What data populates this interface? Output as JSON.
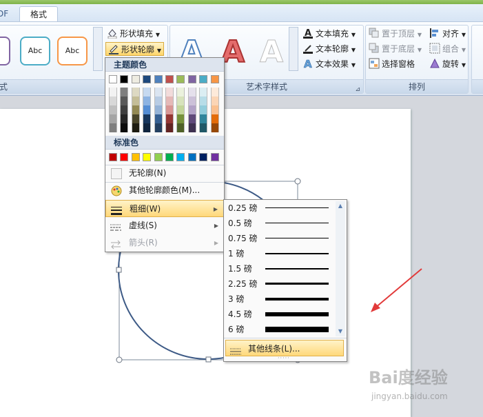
{
  "tabs": {
    "pdf": "DF",
    "format": "格式"
  },
  "ribbon": {
    "shape_styles": {
      "sample": "Abc",
      "label": "式",
      "fill": "形状填充",
      "outline": "形状轮廓"
    },
    "wordart": {
      "label": "艺术字样式",
      "letter": "A",
      "fill": "文本填充",
      "outline": "文本轮廓",
      "effects": "文本效果"
    },
    "arrange": {
      "label": "排列",
      "bring_front": "置于顶层",
      "send_back": "置于底层",
      "selection_pane": "选择窗格",
      "align": "对齐",
      "group": "组合",
      "rotate": "旋转"
    },
    "group_label_left": "式"
  },
  "outline_menu": {
    "theme_colors": "主题颜色",
    "standard_colors": "标准色",
    "no_outline": "无轮廓(N)",
    "more_colors": "其他轮廓颜色(M)...",
    "weight": "粗细(W)",
    "dashes": "虚线(S)",
    "arrows": "箭头(R)"
  },
  "theme_palette": {
    "top": [
      "#ffffff",
      "#000000",
      "#eeece1",
      "#1f497d",
      "#4f81bd",
      "#c0504d",
      "#9bbb59",
      "#8064a2",
      "#4bacc6",
      "#f79646"
    ],
    "shades": [
      [
        "#f2f2f2",
        "#7f7f7f",
        "#ddd9c3",
        "#c6d9f0",
        "#dbe5f1",
        "#f2dcdb",
        "#ebf1dd",
        "#e5e0ec",
        "#dbeef3",
        "#fdeada"
      ],
      [
        "#d8d8d8",
        "#595959",
        "#c4bd97",
        "#8db3e2",
        "#b8cce4",
        "#e5b9b7",
        "#d7e3bc",
        "#ccc1d9",
        "#b7dde8",
        "#fbd5b5"
      ],
      [
        "#bfbfbf",
        "#3f3f3f",
        "#938953",
        "#548dd4",
        "#95b3d7",
        "#d99694",
        "#c3d69b",
        "#b2a2c7",
        "#92cddc",
        "#fac08f"
      ],
      [
        "#a5a5a5",
        "#262626",
        "#494429",
        "#17365d",
        "#366092",
        "#953734",
        "#76923c",
        "#5f497a",
        "#31859b",
        "#e36c09"
      ],
      [
        "#7f7f7f",
        "#0c0c0c",
        "#1d1b10",
        "#0f243e",
        "#244061",
        "#632423",
        "#4f6128",
        "#3f3151",
        "#205867",
        "#974806"
      ]
    ],
    "standard": [
      "#c00000",
      "#ff0000",
      "#ffc000",
      "#ffff00",
      "#92d050",
      "#00b050",
      "#00b0f0",
      "#0070c0",
      "#002060",
      "#7030a0"
    ]
  },
  "weights": [
    {
      "label": "0.25 磅",
      "w": 1
    },
    {
      "label": "0.5 磅",
      "w": 1
    },
    {
      "label": "0.75 磅",
      "w": 1
    },
    {
      "label": "1 磅",
      "w": 2
    },
    {
      "label": "1.5 磅",
      "w": 2
    },
    {
      "label": "2.25 磅",
      "w": 3
    },
    {
      "label": "3 磅",
      "w": 4
    },
    {
      "label": "4.5 磅",
      "w": 6
    },
    {
      "label": "6 磅",
      "w": 8
    }
  ],
  "more_lines": "其他线条(L)...",
  "watermark": {
    "brand": "Bai度经验",
    "url": "jingyan.baidu.com"
  }
}
